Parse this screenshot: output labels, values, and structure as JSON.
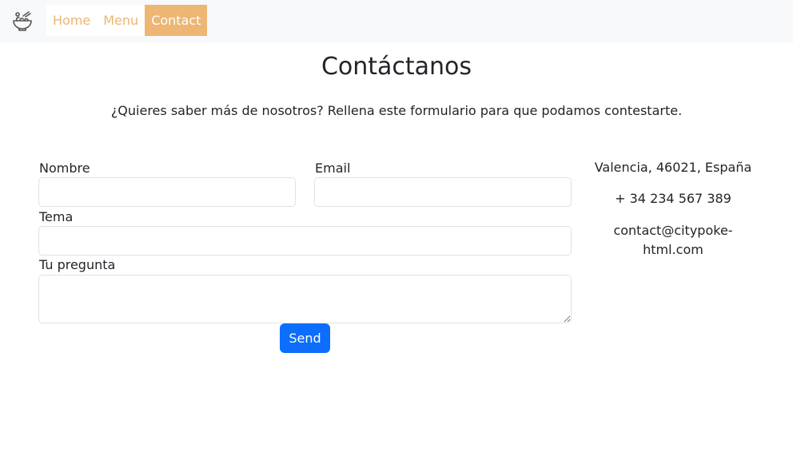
{
  "nav": {
    "logo_icon": "salad-bowl-icon",
    "items": [
      {
        "label": "Home",
        "active": false
      },
      {
        "label": "Menu",
        "active": false
      },
      {
        "label": "Contact",
        "active": true
      }
    ]
  },
  "page": {
    "title": "Contáctanos",
    "subtitle": "¿Quieres saber más de nosotros? Rellena este formulario para que podamos contestarte."
  },
  "form": {
    "name_label": "Nombre",
    "name_value": "",
    "email_label": "Email",
    "email_value": "",
    "topic_label": "Tema",
    "topic_value": "",
    "question_label": "Tu pregunta",
    "question_value": "",
    "send_label": "Send"
  },
  "contact_info": {
    "address": "Valencia, 46021, España",
    "phone": "+ 34 234 567 389",
    "email": "contact@citypoke-html.com"
  },
  "colors": {
    "nav_link": "#ebb672",
    "nav_active_bg": "#edb673",
    "primary_button": "#0d6efd"
  }
}
